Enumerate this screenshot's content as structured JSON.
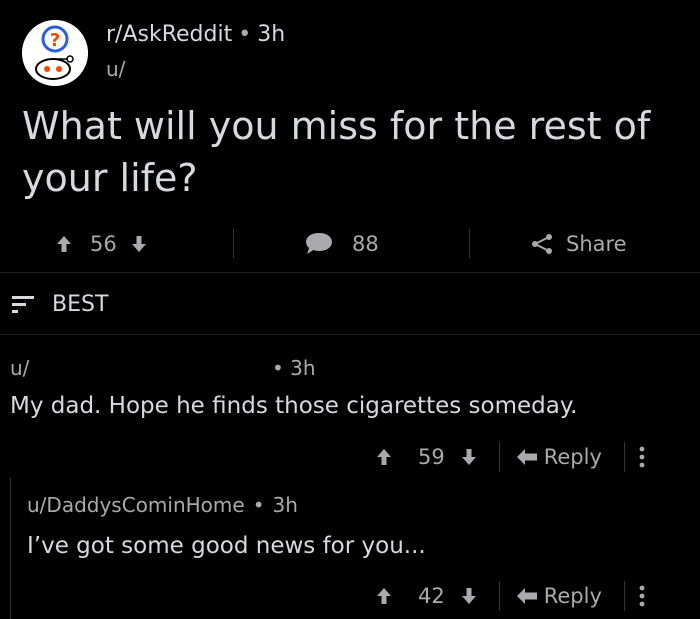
{
  "post": {
    "subreddit": "r/AskReddit",
    "age": "3h",
    "user_prefix": "u/",
    "title": "What will you miss for the rest of your life?",
    "upvotes": "56",
    "comments": "88",
    "share_label": "Share"
  },
  "sort": {
    "label": "BEST"
  },
  "comments": [
    {
      "user": "u/",
      "age": "3h",
      "body": "My dad. Hope he finds those cigarettes someday.",
      "score": "59",
      "reply_label": "Reply"
    },
    {
      "user": "u/DaddysCominHome",
      "age": "3h",
      "body": "I’ve got some good news for you...",
      "score": "42",
      "reply_label": "Reply"
    }
  ],
  "colors": {
    "background": "#000000",
    "text": "#d7dadc",
    "muted": "#a8aaab",
    "avatar_accent": "#ff4500"
  }
}
